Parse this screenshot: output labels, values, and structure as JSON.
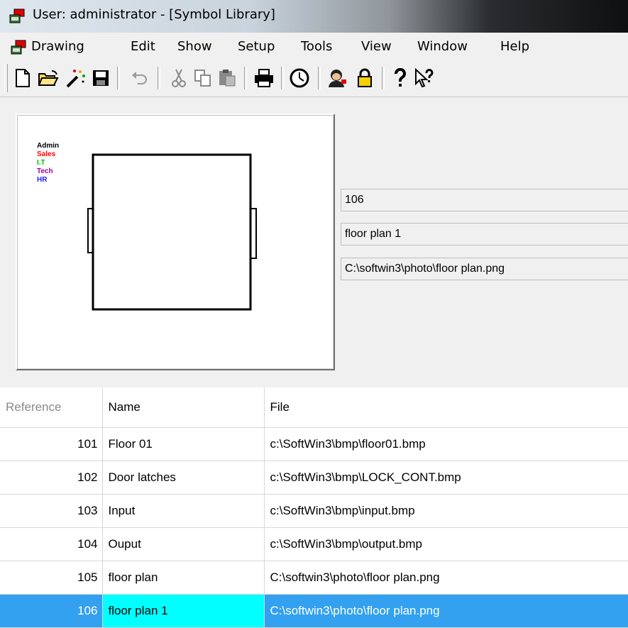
{
  "window": {
    "title": "User: administrator - [Symbol Library]"
  },
  "menu": {
    "items": [
      "Drawing",
      "Edit",
      "Show",
      "Setup",
      "Tools",
      "View",
      "Window",
      "Help"
    ]
  },
  "toolbar": {
    "icons": [
      "new-icon",
      "open-icon",
      "magic-wand-icon",
      "save-icon",
      "undo-icon",
      "cut-icon",
      "copy-icon",
      "paste-icon",
      "print-icon",
      "clock-icon",
      "user-icon",
      "lock-icon",
      "help-icon",
      "context-help-icon"
    ]
  },
  "preview": {
    "legend": [
      {
        "label": "Admin",
        "color": "#000000"
      },
      {
        "label": "Sales",
        "color": "#ff0000"
      },
      {
        "label": "I.T",
        "color": "#00c000"
      },
      {
        "label": "Tech",
        "color": "#a000a0"
      },
      {
        "label": "HR",
        "color": "#2020ff"
      }
    ]
  },
  "details": {
    "reference": "106",
    "name": "floor plan 1",
    "file": "C:\\softwin3\\photo\\floor plan.png"
  },
  "table": {
    "columns": [
      "Reference",
      "Name",
      "File"
    ],
    "rows": [
      {
        "ref": "101",
        "name": "Floor 01",
        "file": "c:\\SoftWin3\\bmp\\floor01.bmp"
      },
      {
        "ref": "102",
        "name": "Door latches",
        "file": "c:\\SoftWin3\\bmp\\LOCK_CONT.bmp"
      },
      {
        "ref": "103",
        "name": "Input",
        "file": "c:\\SoftWin3\\bmp\\input.bmp"
      },
      {
        "ref": "104",
        "name": "Ouput",
        "file": "c:\\SoftWin3\\bmp\\output.bmp"
      },
      {
        "ref": "105",
        "name": "floor plan",
        "file": "C:\\softwin3\\photo\\floor plan.png"
      },
      {
        "ref": "106",
        "name": "floor plan 1",
        "file": "C:\\softwin3\\photo\\floor plan.png"
      }
    ],
    "selected_index": 5
  },
  "colors": {
    "selection": "#33a1ef",
    "selection_cell": "#00ffff"
  }
}
